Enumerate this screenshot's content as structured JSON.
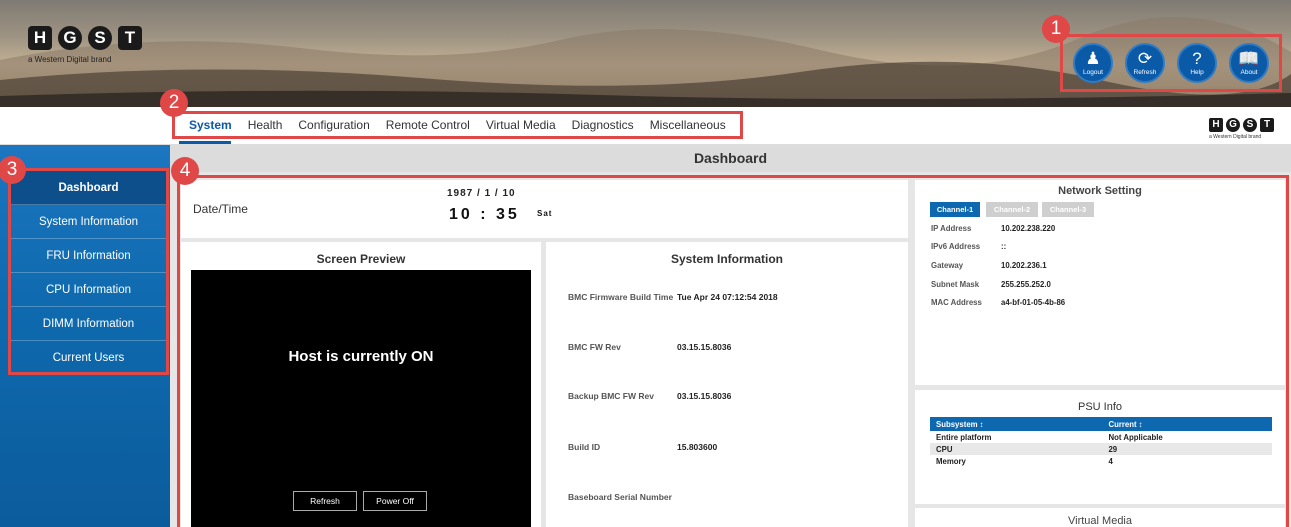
{
  "brand": {
    "letters": [
      "H",
      "G",
      "S",
      "T"
    ],
    "tagline": "a Western Digital brand"
  },
  "header_buttons": [
    {
      "label": "Logout",
      "icon": "logout-icon"
    },
    {
      "label": "Refresh",
      "icon": "refresh-icon"
    },
    {
      "label": "Help",
      "icon": "help-icon"
    },
    {
      "label": "About",
      "icon": "about-book-icon"
    }
  ],
  "markers": [
    "1",
    "2",
    "3",
    "4"
  ],
  "nav": {
    "tabs": [
      "System",
      "Health",
      "Configuration",
      "Remote Control",
      "Virtual Media",
      "Diagnostics",
      "Miscellaneous"
    ],
    "active": "System"
  },
  "sidebar": {
    "items": [
      "Dashboard",
      "System Information",
      "FRU Information",
      "CPU Information",
      "DIMM Information",
      "Current Users"
    ],
    "active": "Dashboard"
  },
  "dashboard": {
    "title": "Dashboard",
    "datetime": {
      "label": "Date/Time",
      "date": "1987 / 1 / 10",
      "time": "10 : 35",
      "day": "Sat"
    },
    "screen_preview": {
      "title": "Screen Preview",
      "status": "Host is currently ON",
      "refresh_label": "Refresh",
      "power_off_label": "Power Off"
    },
    "system_information": {
      "title": "System Information",
      "rows": [
        {
          "label": "BMC Firmware Build Time",
          "value": "Tue Apr 24 07:12:54 2018"
        },
        {
          "label": "BMC FW Rev",
          "value": "03.15.15.8036"
        },
        {
          "label": "Backup BMC FW Rev",
          "value": "03.15.15.8036"
        },
        {
          "label": "Build ID",
          "value": "15.803600"
        },
        {
          "label": "Baseboard Serial Number",
          "value": ""
        }
      ]
    },
    "network_setting": {
      "title": "Network Setting",
      "channels": [
        "Channel-1",
        "Channel-2",
        "Channel-3"
      ],
      "active_channel": "Channel-1",
      "rows": [
        {
          "label": "IP Address",
          "value": "10.202.238.220"
        },
        {
          "label": "IPv6 Address",
          "value": "::"
        },
        {
          "label": "Gateway",
          "value": "10.202.236.1"
        },
        {
          "label": "Subnet Mask",
          "value": "255.255.252.0"
        },
        {
          "label": "MAC Address",
          "value": "a4-bf-01-05-4b-86"
        }
      ]
    },
    "psu_info": {
      "title": "PSU Info",
      "columns": [
        "Subsystem ↕",
        "Current ↕"
      ],
      "rows": [
        [
          "Entire platform",
          "Not Applicable"
        ],
        [
          "CPU",
          "29"
        ],
        [
          "Memory",
          "4"
        ]
      ]
    },
    "virtual_media": {
      "title": "Virtual Media"
    }
  },
  "colors": {
    "accent": "#0a5aa8",
    "annotation": "#e04848",
    "sidebar": "#0f6aaf"
  }
}
